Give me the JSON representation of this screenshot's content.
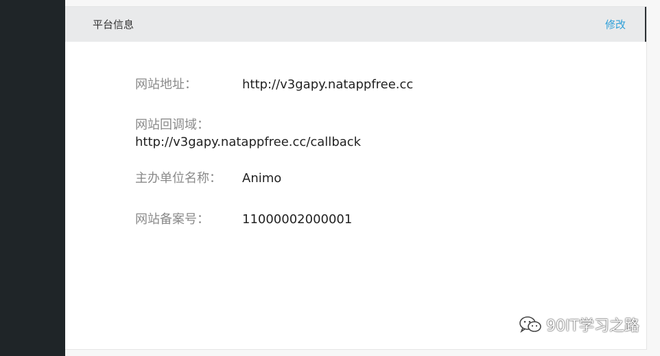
{
  "header": {
    "title": "平台信息",
    "edit_label": "修改"
  },
  "info": {
    "site_url": {
      "label": "网站地址：",
      "value": "http://v3gapy.natappfree.cc"
    },
    "callback_domain": {
      "label": "网站回调域：",
      "value": "http://v3gapy.natappfree.cc/callback"
    },
    "organizer": {
      "label": "主办单位名称：",
      "value": "Animo"
    },
    "icp_number": {
      "label": "网站备案号：",
      "value": "11000002000001"
    }
  },
  "watermark": {
    "text": "90IT学习之路"
  },
  "colors": {
    "sidebar": "#1f2528",
    "header_bg": "#e9eaeb",
    "link": "#2d9fd8",
    "label": "#8a8a8a",
    "value": "#222222"
  }
}
